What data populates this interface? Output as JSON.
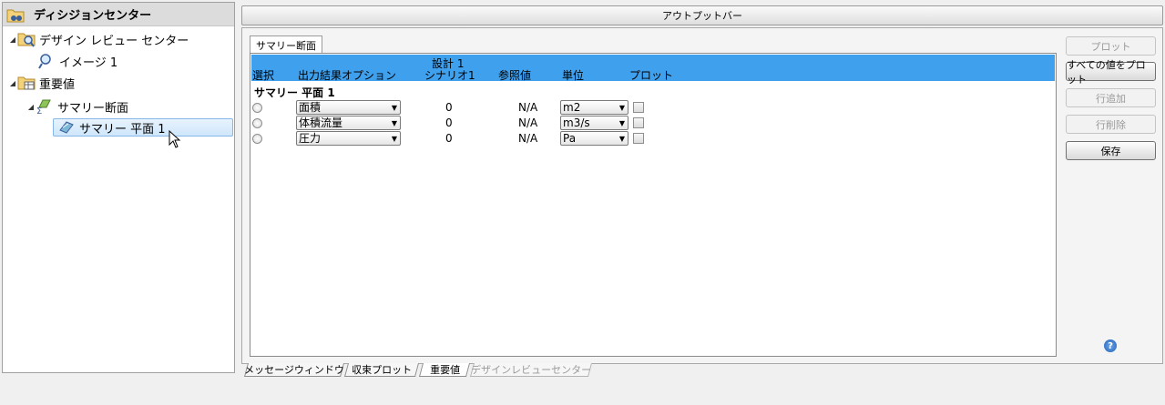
{
  "tree": {
    "header": "ディシジョンセンター",
    "items": [
      {
        "label": "デザイン レビュー センター"
      },
      {
        "label": "イメージ 1"
      },
      {
        "label": "重要値"
      },
      {
        "label": "サマリー断面"
      },
      {
        "label": "サマリー 平面 1"
      }
    ]
  },
  "output_bar": "アウトプットバー",
  "tab": "サマリー断面",
  "grid": {
    "headers": {
      "select": "選択",
      "option": "出力結果オプション",
      "design_line1": "設計 1",
      "design_line2": "シナリオ1",
      "reference": "参照値",
      "unit": "単位",
      "plot": "プロット"
    },
    "group_title": "サマリー 平面 1",
    "rows": [
      {
        "option": "面積",
        "value": "0",
        "reference": "N/A",
        "unit": "m2"
      },
      {
        "option": "体積流量",
        "value": "0",
        "reference": "N/A",
        "unit": "m3/s"
      },
      {
        "option": "圧力",
        "value": "0",
        "reference": "N/A",
        "unit": "Pa"
      }
    ]
  },
  "buttons": {
    "plot": "プロット",
    "plot_all": "すべての値をプロット",
    "add_row": "行追加",
    "delete_row": "行削除",
    "save": "保存"
  },
  "bottom_tabs": [
    "メッセージウィンドウ",
    "収束プロット",
    "重要値",
    "デザインレビューセンター"
  ],
  "icons": {
    "help": "help-icon"
  },
  "colors": {
    "header_bg": "#3fa0ee",
    "selection": "#cfe6fb"
  }
}
